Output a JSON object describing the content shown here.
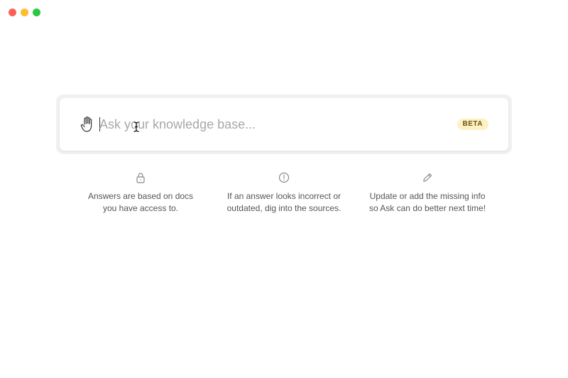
{
  "window": {
    "controls": [
      "close-button",
      "minimize-button",
      "zoom-button"
    ],
    "colors": {
      "close": "#fe5f57",
      "minimize": "#febc2e",
      "zoom": "#28c840"
    }
  },
  "search": {
    "icon": "hand-icon",
    "placeholder": "Ask your knowledge base...",
    "value": "",
    "badge": "BETA",
    "badge_color": "#fdf1c4"
  },
  "tips": [
    {
      "icon": "lock-icon",
      "line1": "Answers are based on docs",
      "line2": "you have access to."
    },
    {
      "icon": "alert-circle-icon",
      "line1": "If an answer looks incorrect or",
      "line2": "outdated, dig into the sources."
    },
    {
      "icon": "pencil-icon",
      "line1": "Update or add the missing info",
      "line2": "so Ask can do better next time!"
    }
  ]
}
